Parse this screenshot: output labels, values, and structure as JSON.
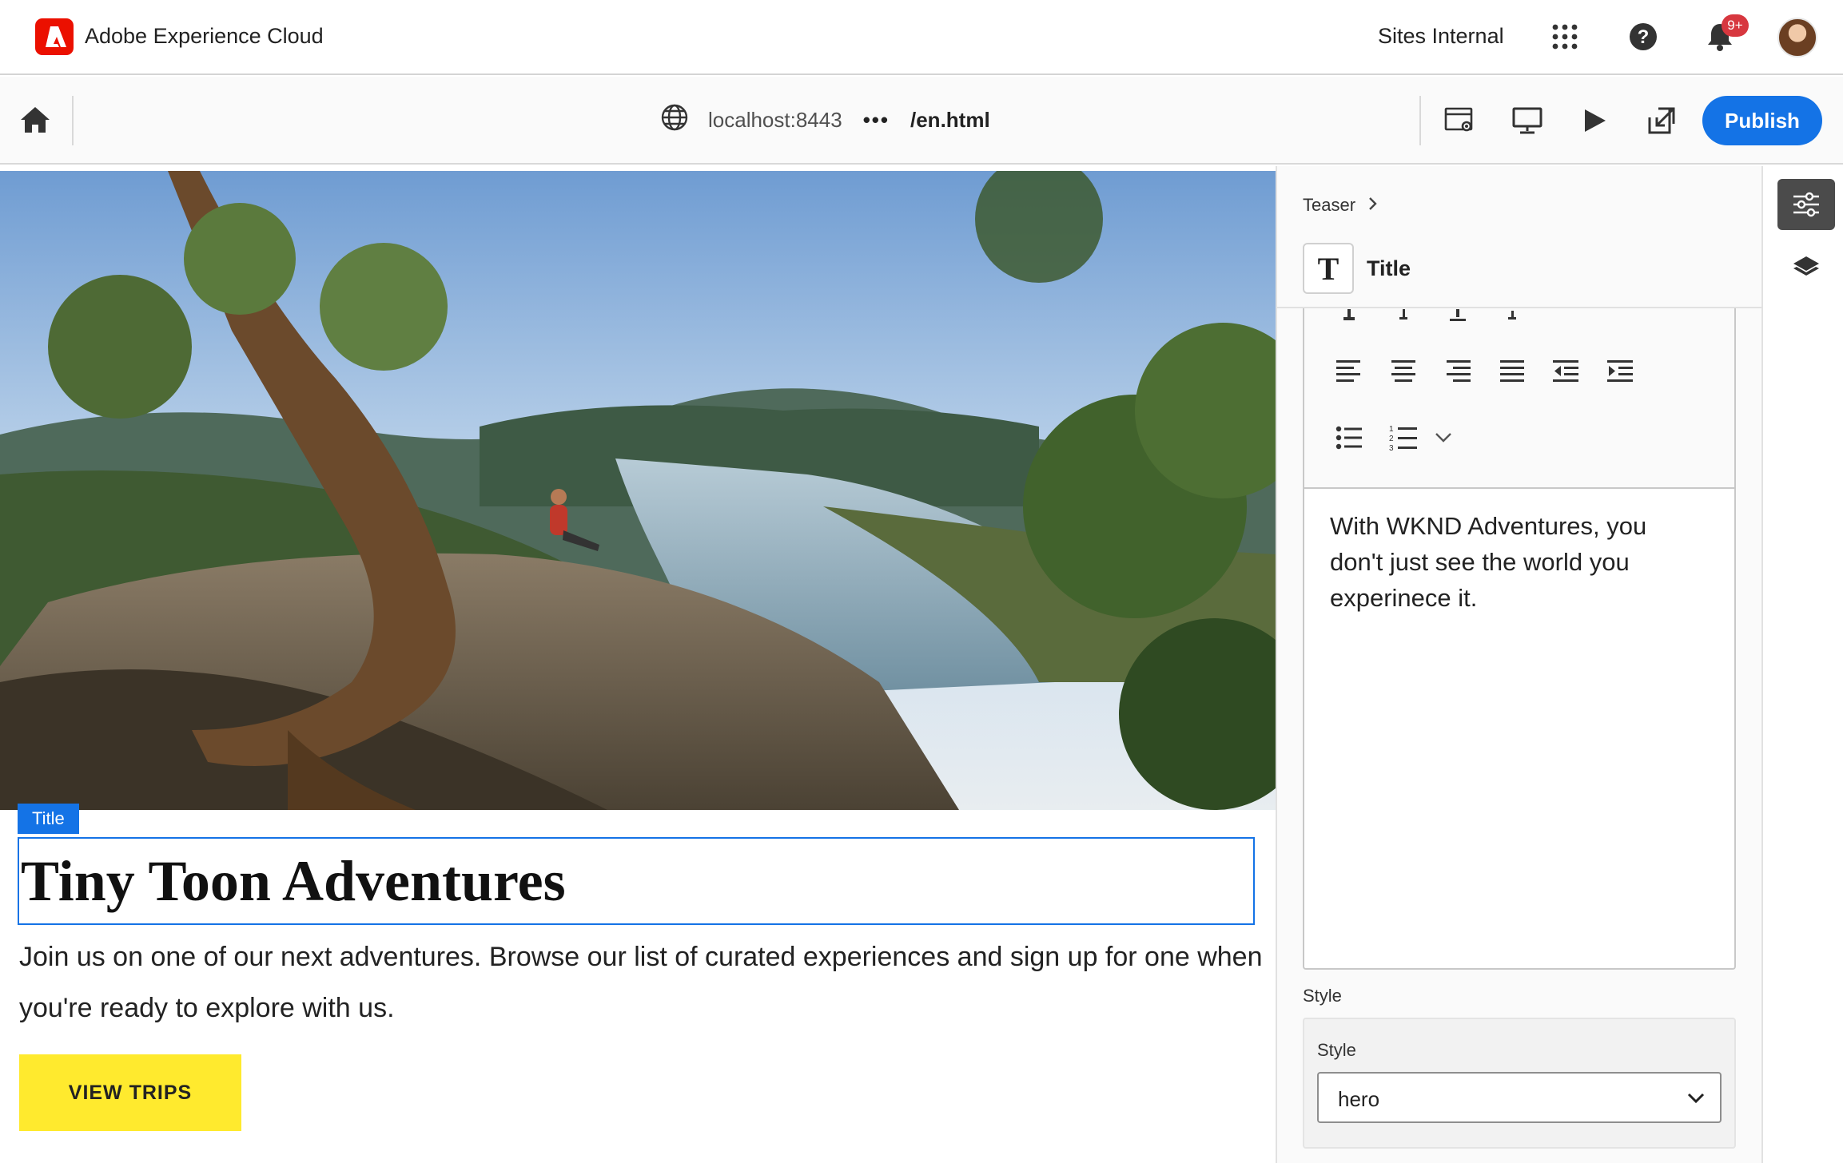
{
  "shell": {
    "brand": "Adobe Experience Cloud",
    "org": "Sites Internal",
    "notifications_badge": "9+",
    "icons": [
      "apps-grid-icon",
      "help-icon",
      "bell-icon",
      "avatar"
    ]
  },
  "toolbar": {
    "host": "localhost:8443",
    "more": "•••",
    "path": "/en.html",
    "publish_label": "Publish",
    "icons": [
      "home-icon",
      "globe-icon",
      "page-settings-icon",
      "desktop-preview-icon",
      "play-preview-icon",
      "open-in-new-icon"
    ]
  },
  "canvas": {
    "selected_chip": "Title",
    "hero_title": "Tiny Toon Adventures",
    "hero_text": "Join us on one of our next adventures. Browse our list of curated experiences and sign up for one when you're ready to explore with us.",
    "cta_label": "VIEW TRIPS"
  },
  "panel": {
    "breadcrumb": "Teaser",
    "component_icon": "T",
    "component_name": "Title",
    "rte_text": "With WKND Adventures, you don't just see the world you experinece it.",
    "style_section_label": "Style",
    "style_field_label": "Style",
    "style_value": "hero"
  },
  "rail": {
    "icons": [
      "properties-icon",
      "layers-icon"
    ]
  },
  "colors": {
    "accent": "#1473e6",
    "adobe_red": "#eb1000",
    "cta_yellow": "#ffea2e",
    "badge_red": "#d7373f"
  }
}
